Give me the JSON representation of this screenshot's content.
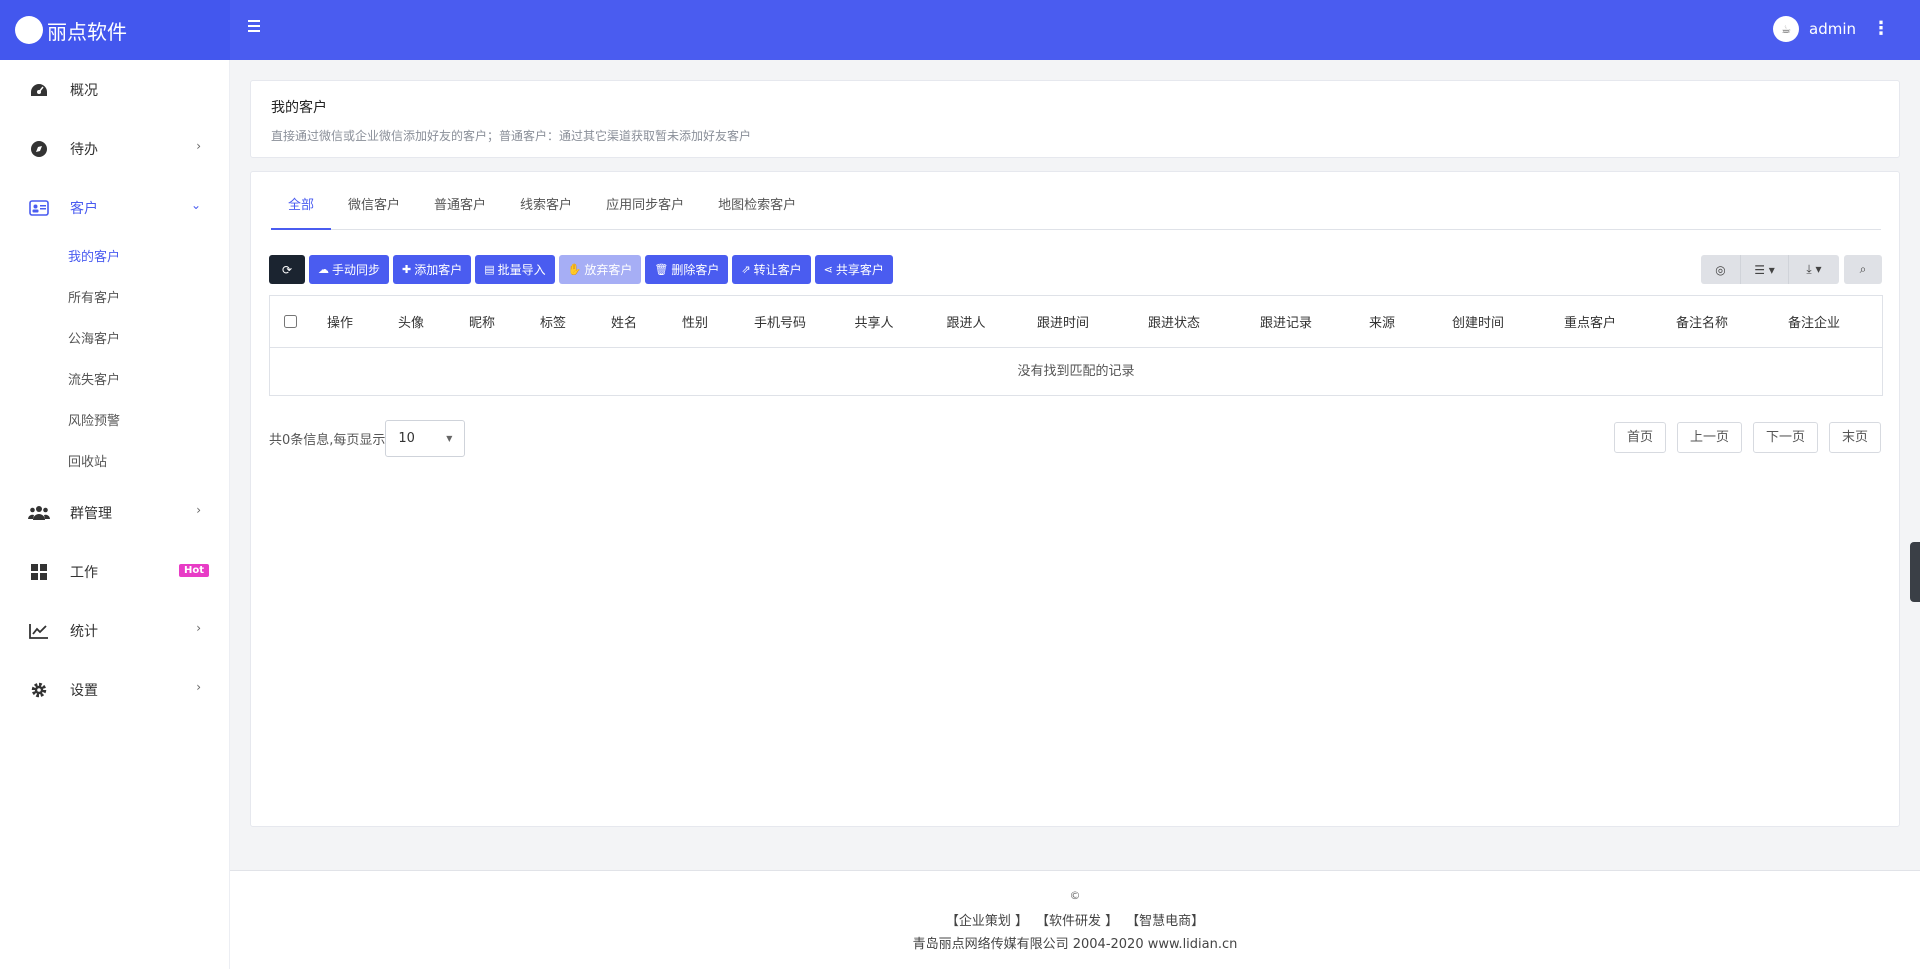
{
  "brand": {
    "title": "丽点软件"
  },
  "header": {
    "user_name": "admin"
  },
  "sidebar": {
    "items": [
      {
        "label": "概况"
      },
      {
        "label": "待办"
      },
      {
        "label": "客户"
      },
      {
        "label": "群管理"
      },
      {
        "label": "工作",
        "badge": "Hot"
      },
      {
        "label": "统计"
      },
      {
        "label": "设置"
      }
    ],
    "customer_sub": [
      {
        "label": "我的客户"
      },
      {
        "label": "所有客户"
      },
      {
        "label": "公海客户"
      },
      {
        "label": "流失客户"
      },
      {
        "label": "风险预警"
      },
      {
        "label": "回收站"
      }
    ]
  },
  "page": {
    "title": "我的客户",
    "description": "直接通过微信或企业微信添加好友的客户；普通客户：通过其它渠道获取暂未添加好友客户"
  },
  "tabs": [
    "全部",
    "微信客户",
    "普通客户",
    "线索客户",
    "应用同步客户",
    "地图检索客户"
  ],
  "toolbar": {
    "sync": "手动同步",
    "add": "添加客户",
    "import": "批量导入",
    "abandon": "放弃客户",
    "delete": "删除客户",
    "transfer": "转让客户",
    "share": "共享客户"
  },
  "table": {
    "columns": [
      "操作",
      "头像",
      "昵称",
      "标签",
      "姓名",
      "性别",
      "手机号码",
      "共享人",
      "跟进人",
      "跟进时间",
      "跟进状态",
      "跟进记录",
      "来源",
      "创建时间",
      "重点客户",
      "备注名称",
      "备注企业"
    ],
    "empty_text": "没有找到匹配的记录"
  },
  "pagination": {
    "info": "共0条信息,每页显示",
    "page_size": "10",
    "first": "首页",
    "prev": "上一页",
    "next": "下一页",
    "last": "末页"
  },
  "footer": {
    "copyright": "©",
    "links": [
      "【企业策划 】",
      "【软件研发 】",
      "【智慧电商】"
    ],
    "company": "青岛丽点网络传媒有限公司 2004-2020 www.lidian.cn"
  },
  "colors": {
    "primary": "#4a5cf0",
    "hot_badge": "#e83cc6"
  }
}
